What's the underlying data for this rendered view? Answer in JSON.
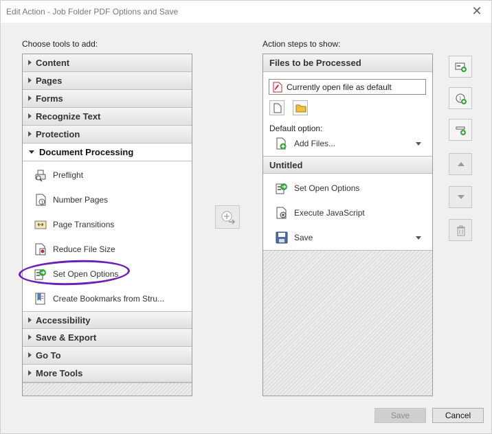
{
  "window": {
    "title": "Edit Action - Job Folder PDF Options and Save"
  },
  "left": {
    "heading": "Choose tools to add:",
    "categories_top": [
      "Content",
      "Pages",
      "Forms",
      "Recognize Text",
      "Protection"
    ],
    "open_category": "Document Processing",
    "tools": [
      {
        "label": "Preflight",
        "icon": "preflight-icon"
      },
      {
        "label": "Number Pages",
        "icon": "number-pages-icon"
      },
      {
        "label": "Page Transitions",
        "icon": "page-transitions-icon"
      },
      {
        "label": "Reduce File Size",
        "icon": "reduce-file-size-icon"
      },
      {
        "label": "Set Open Options",
        "icon": "set-open-options-icon"
      },
      {
        "label": "Create Bookmarks from Stru...",
        "icon": "bookmarks-icon"
      }
    ],
    "categories_bottom": [
      "Accessibility",
      "Save & Export",
      "Go To",
      "More Tools"
    ]
  },
  "right": {
    "heading": "Action steps to show:",
    "files_header": "Files to be Processed",
    "file_value": "Currently open file as default",
    "default_option_label": "Default option:",
    "add_files_label": "Add Files...",
    "untitled_header": "Untitled",
    "steps": [
      {
        "label": "Set Open Options",
        "icon": "set-open-options-icon",
        "dropdown": false
      },
      {
        "label": "Execute JavaScript",
        "icon": "javascript-gear-icon",
        "dropdown": false
      },
      {
        "label": "Save",
        "icon": "floppy-disk-icon",
        "dropdown": true
      }
    ]
  },
  "footer": {
    "save_label": "Save",
    "cancel_label": "Cancel"
  },
  "colors": {
    "annotation_circle": "#6a1fb8",
    "accent_green": "#3aa63a",
    "pdf_red": "#c4262e"
  }
}
